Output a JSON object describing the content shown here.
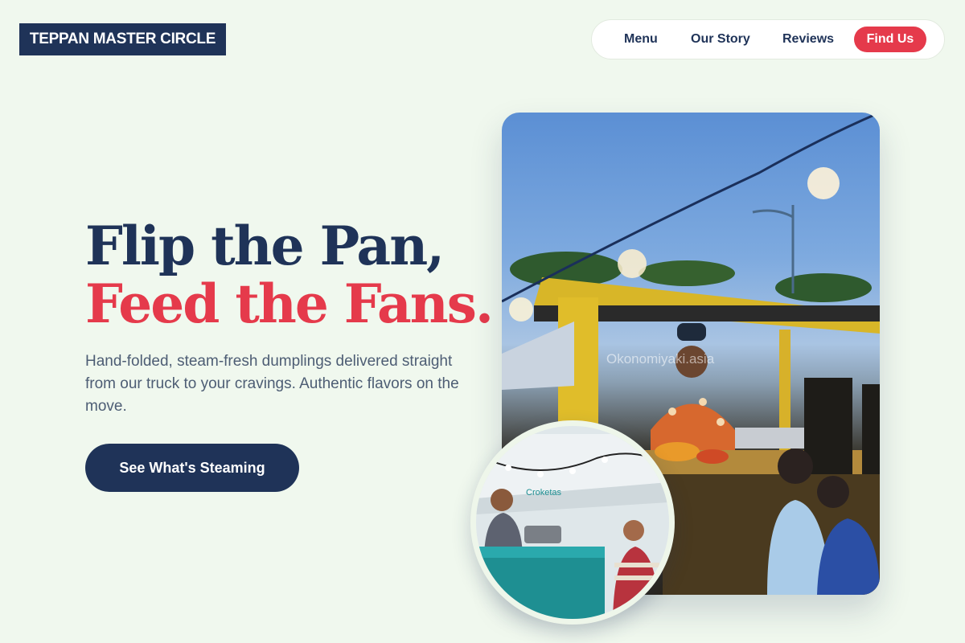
{
  "brand": {
    "name": "TEPPAN MASTER CIRCLE"
  },
  "nav": {
    "items": [
      "Menu",
      "Our Story",
      "Reviews"
    ],
    "cta": "Find Us"
  },
  "hero": {
    "headline_line1": "Flip the Pan,",
    "headline_line2": "Feed the Fans.",
    "subtitle": "Hand-folded, steam-fresh dumplings delivered straight from our truck to your cravings. Authentic flavors on the move.",
    "button": "See What's Steaming"
  },
  "images": {
    "main_photo": "food-truck-vendor-photo",
    "inset_photo": "food-stall-cook-photo",
    "main_truck_text": "Okonomiyaki.asia",
    "inset_truck_text": "Croketas"
  },
  "colors": {
    "background": "#f0f8ee",
    "navy": "#1f3358",
    "red": "#e53a4b",
    "text_muted": "#4d5d74"
  }
}
